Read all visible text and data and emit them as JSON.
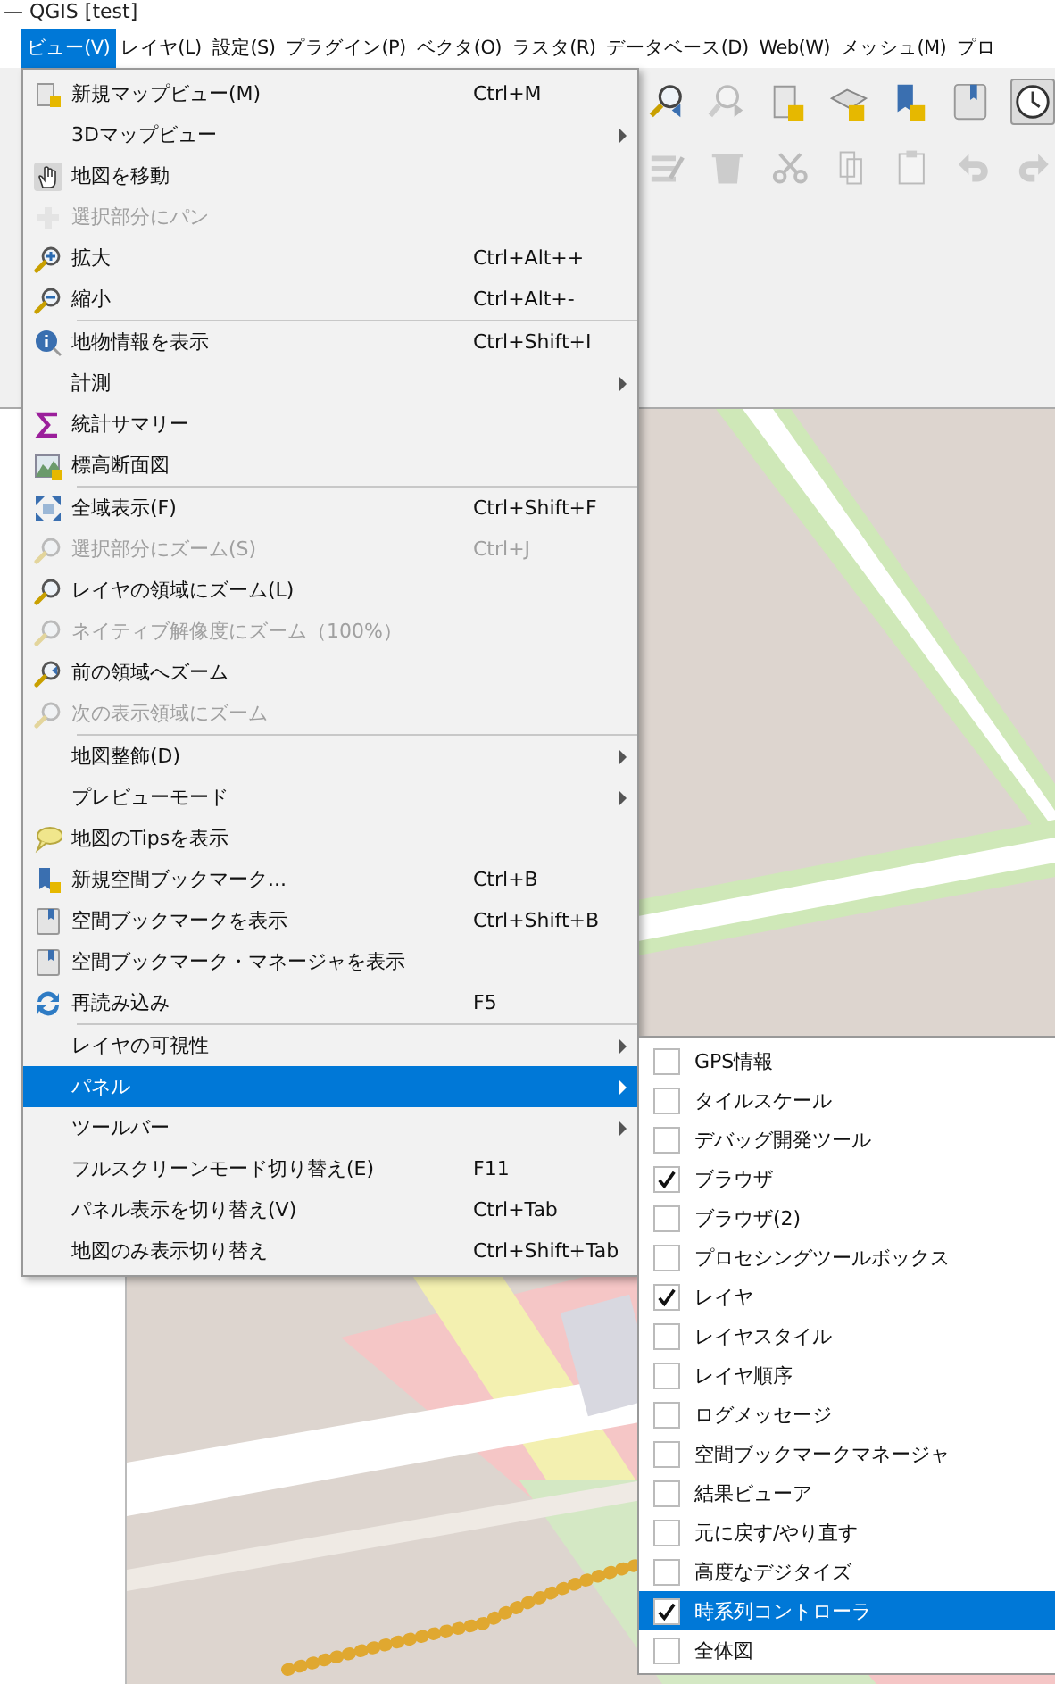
{
  "window": {
    "title": "— QGIS [test]"
  },
  "menu_bar": [
    {
      "label": "ビュー(V)",
      "selected": true
    },
    {
      "label": "レイヤ(L)",
      "selected": false
    },
    {
      "label": "設定(S)",
      "selected": false
    },
    {
      "label": "プラグイン(P)",
      "selected": false
    },
    {
      "label": "ベクタ(O)",
      "selected": false
    },
    {
      "label": "ラスタ(R)",
      "selected": false
    },
    {
      "label": "データベース(D)",
      "selected": false
    },
    {
      "label": "Web(W)",
      "selected": false
    },
    {
      "label": "メッシュ(M)",
      "selected": false
    },
    {
      "label": "プロ",
      "selected": false
    }
  ],
  "view_menu": {
    "items": [
      {
        "kind": "item",
        "label": "新規マップビュー(M)",
        "shortcut": "Ctrl+M",
        "disabled": false,
        "selected": false
      },
      {
        "kind": "submenu",
        "label": "3Dマップビュー",
        "disabled": false,
        "selected": false
      },
      {
        "kind": "item",
        "label": "地図を移動",
        "disabled": false,
        "selected": false
      },
      {
        "kind": "item",
        "label": "選択部分にパン",
        "disabled": true,
        "selected": false
      },
      {
        "kind": "item",
        "label": "拡大",
        "shortcut": "Ctrl+Alt++",
        "disabled": false,
        "selected": false
      },
      {
        "kind": "item",
        "label": "縮小",
        "shortcut": "Ctrl+Alt+-",
        "disabled": false,
        "selected": false
      },
      {
        "kind": "separator"
      },
      {
        "kind": "item",
        "label": "地物情報を表示",
        "shortcut": "Ctrl+Shift+I",
        "disabled": false,
        "selected": false
      },
      {
        "kind": "submenu",
        "label": "計測",
        "disabled": false,
        "selected": false
      },
      {
        "kind": "item",
        "label": "統計サマリー",
        "disabled": false,
        "selected": false
      },
      {
        "kind": "item",
        "label": "標高断面図",
        "disabled": false,
        "selected": false
      },
      {
        "kind": "separator"
      },
      {
        "kind": "item",
        "label": "全域表示(F)",
        "shortcut": "Ctrl+Shift+F",
        "disabled": false,
        "selected": false
      },
      {
        "kind": "item",
        "label": "選択部分にズーム(S)",
        "shortcut": "Ctrl+J",
        "disabled": true,
        "selected": false
      },
      {
        "kind": "item",
        "label": "レイヤの領域にズーム(L)",
        "disabled": false,
        "selected": false
      },
      {
        "kind": "item",
        "label": "ネイティブ解像度にズーム（100%）",
        "disabled": true,
        "selected": false
      },
      {
        "kind": "item",
        "label": "前の領域へズーム",
        "disabled": false,
        "selected": false
      },
      {
        "kind": "item",
        "label": "次の表示領域にズーム",
        "disabled": true,
        "selected": false
      },
      {
        "kind": "separator"
      },
      {
        "kind": "submenu",
        "label": "地図整飾(D)",
        "disabled": false,
        "selected": false
      },
      {
        "kind": "submenu",
        "label": "プレビューモード",
        "disabled": false,
        "selected": false
      },
      {
        "kind": "item",
        "label": "地図のTipsを表示",
        "disabled": false,
        "selected": false
      },
      {
        "kind": "item",
        "label": "新規空間ブックマーク...",
        "shortcut": "Ctrl+B",
        "disabled": false,
        "selected": false
      },
      {
        "kind": "item",
        "label": "空間ブックマークを表示",
        "shortcut": "Ctrl+Shift+B",
        "disabled": false,
        "selected": false
      },
      {
        "kind": "item",
        "label": "空間ブックマーク・マネージャを表示",
        "disabled": false,
        "selected": false
      },
      {
        "kind": "item",
        "label": "再読み込み",
        "shortcut": "F5",
        "disabled": false,
        "selected": false
      },
      {
        "kind": "separator"
      },
      {
        "kind": "submenu",
        "label": "レイヤの可視性",
        "disabled": false,
        "selected": false
      },
      {
        "kind": "submenu",
        "label": "パネル",
        "disabled": false,
        "selected": true
      },
      {
        "kind": "submenu",
        "label": "ツールバー",
        "disabled": false,
        "selected": false
      },
      {
        "kind": "item",
        "label": "フルスクリーンモード切り替え(E)",
        "shortcut": "F11",
        "disabled": false,
        "selected": false
      },
      {
        "kind": "item",
        "label": "パネル表示を切り替え(V)",
        "shortcut": "Ctrl+Tab",
        "disabled": false,
        "selected": false
      },
      {
        "kind": "item",
        "label": "地図のみ表示切り替え",
        "shortcut": "Ctrl+Shift+Tab",
        "disabled": false,
        "selected": false
      }
    ]
  },
  "panels_submenu": {
    "items": [
      {
        "label": "GPS情報",
        "checked": false,
        "selected": false
      },
      {
        "label": "タイルスケール",
        "checked": false,
        "selected": false
      },
      {
        "label": "デバッグ開発ツール",
        "checked": false,
        "selected": false
      },
      {
        "label": "ブラウザ",
        "checked": true,
        "selected": false
      },
      {
        "label": "ブラウザ(2)",
        "checked": false,
        "selected": false
      },
      {
        "label": "プロセシングツールボックス",
        "checked": false,
        "selected": false
      },
      {
        "label": "レイヤ",
        "checked": true,
        "selected": false
      },
      {
        "label": "レイヤスタイル",
        "checked": false,
        "selected": false
      },
      {
        "label": "レイヤ順序",
        "checked": false,
        "selected": false
      },
      {
        "label": "ログメッセージ",
        "checked": false,
        "selected": false
      },
      {
        "label": "空間ブックマークマネージャ",
        "checked": false,
        "selected": false
      },
      {
        "label": "結果ビューア",
        "checked": false,
        "selected": false
      },
      {
        "label": "元に戻す/やり直す",
        "checked": false,
        "selected": false
      },
      {
        "label": "高度なデジタイズ",
        "checked": false,
        "selected": false
      },
      {
        "label": "時系列コントローラ",
        "checked": true,
        "selected": true
      },
      {
        "label": "全体図",
        "checked": false,
        "selected": false
      }
    ]
  }
}
